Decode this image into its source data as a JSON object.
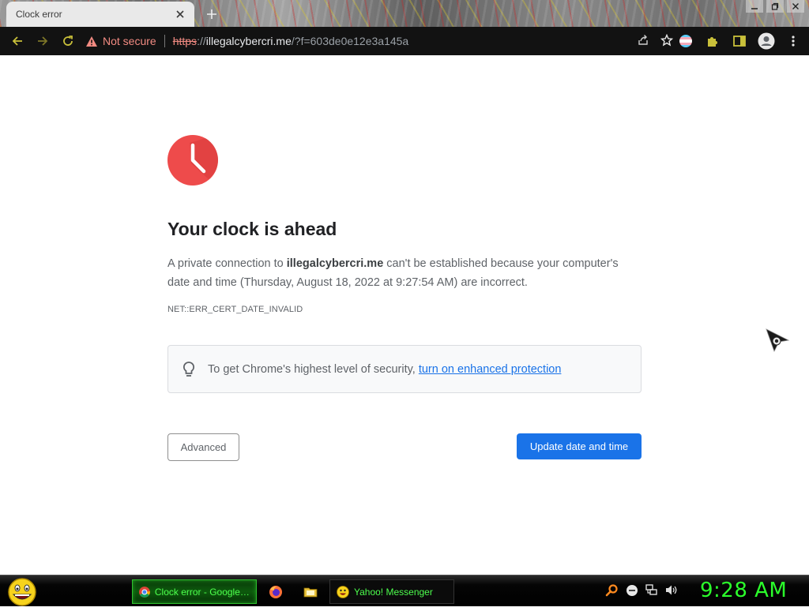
{
  "browser": {
    "tab": {
      "title": "Clock error"
    },
    "omnibox": {
      "security_label": "Not secure",
      "url_scheme": "https",
      "url_separator": "://",
      "url_host": "illegalcybercri.me",
      "url_rest": "/?f=603de0e12e3a145a"
    },
    "toolbar_icons": [
      "back-icon",
      "forward-icon",
      "reload-icon",
      "share-icon",
      "bookmark-star-icon",
      "flag-extension-icon",
      "extensions-puzzle-icon",
      "side-panel-icon",
      "profile-icon",
      "menu-kebab-icon"
    ]
  },
  "page": {
    "icon": "clock-error-icon",
    "heading": "Your clock is ahead",
    "message_prefix": "A private connection to ",
    "message_host": "illegalcybercri.me",
    "message_suffix": " can't be established because your computer's date and time (Thursday, August 18, 2022 at 9:27:54 AM) are incorrect.",
    "error_code": "NET::ERR_CERT_DATE_INVALID",
    "enhanced": {
      "text": "To get Chrome's highest level of security, ",
      "link": "turn on enhanced protection"
    },
    "buttons": {
      "advanced": "Advanced",
      "update": "Update date and time"
    }
  },
  "taskbar": {
    "items": [
      {
        "label": "Clock error - Google ...",
        "icon": "chrome-icon",
        "active": true
      },
      {
        "label": "",
        "icon": "firefox-icon"
      },
      {
        "label": "",
        "icon": "folder-icon"
      },
      {
        "label": "Yahoo! Messenger",
        "icon": "yahoo-messenger-icon"
      }
    ],
    "clock": "9:28 AM"
  },
  "colors": {
    "primary_button": "#1a73e8",
    "link": "#1a73e8",
    "error_red": "#ee4b4b",
    "not_secure": "#f28b82",
    "taskbar_green": "#2bff2b"
  }
}
